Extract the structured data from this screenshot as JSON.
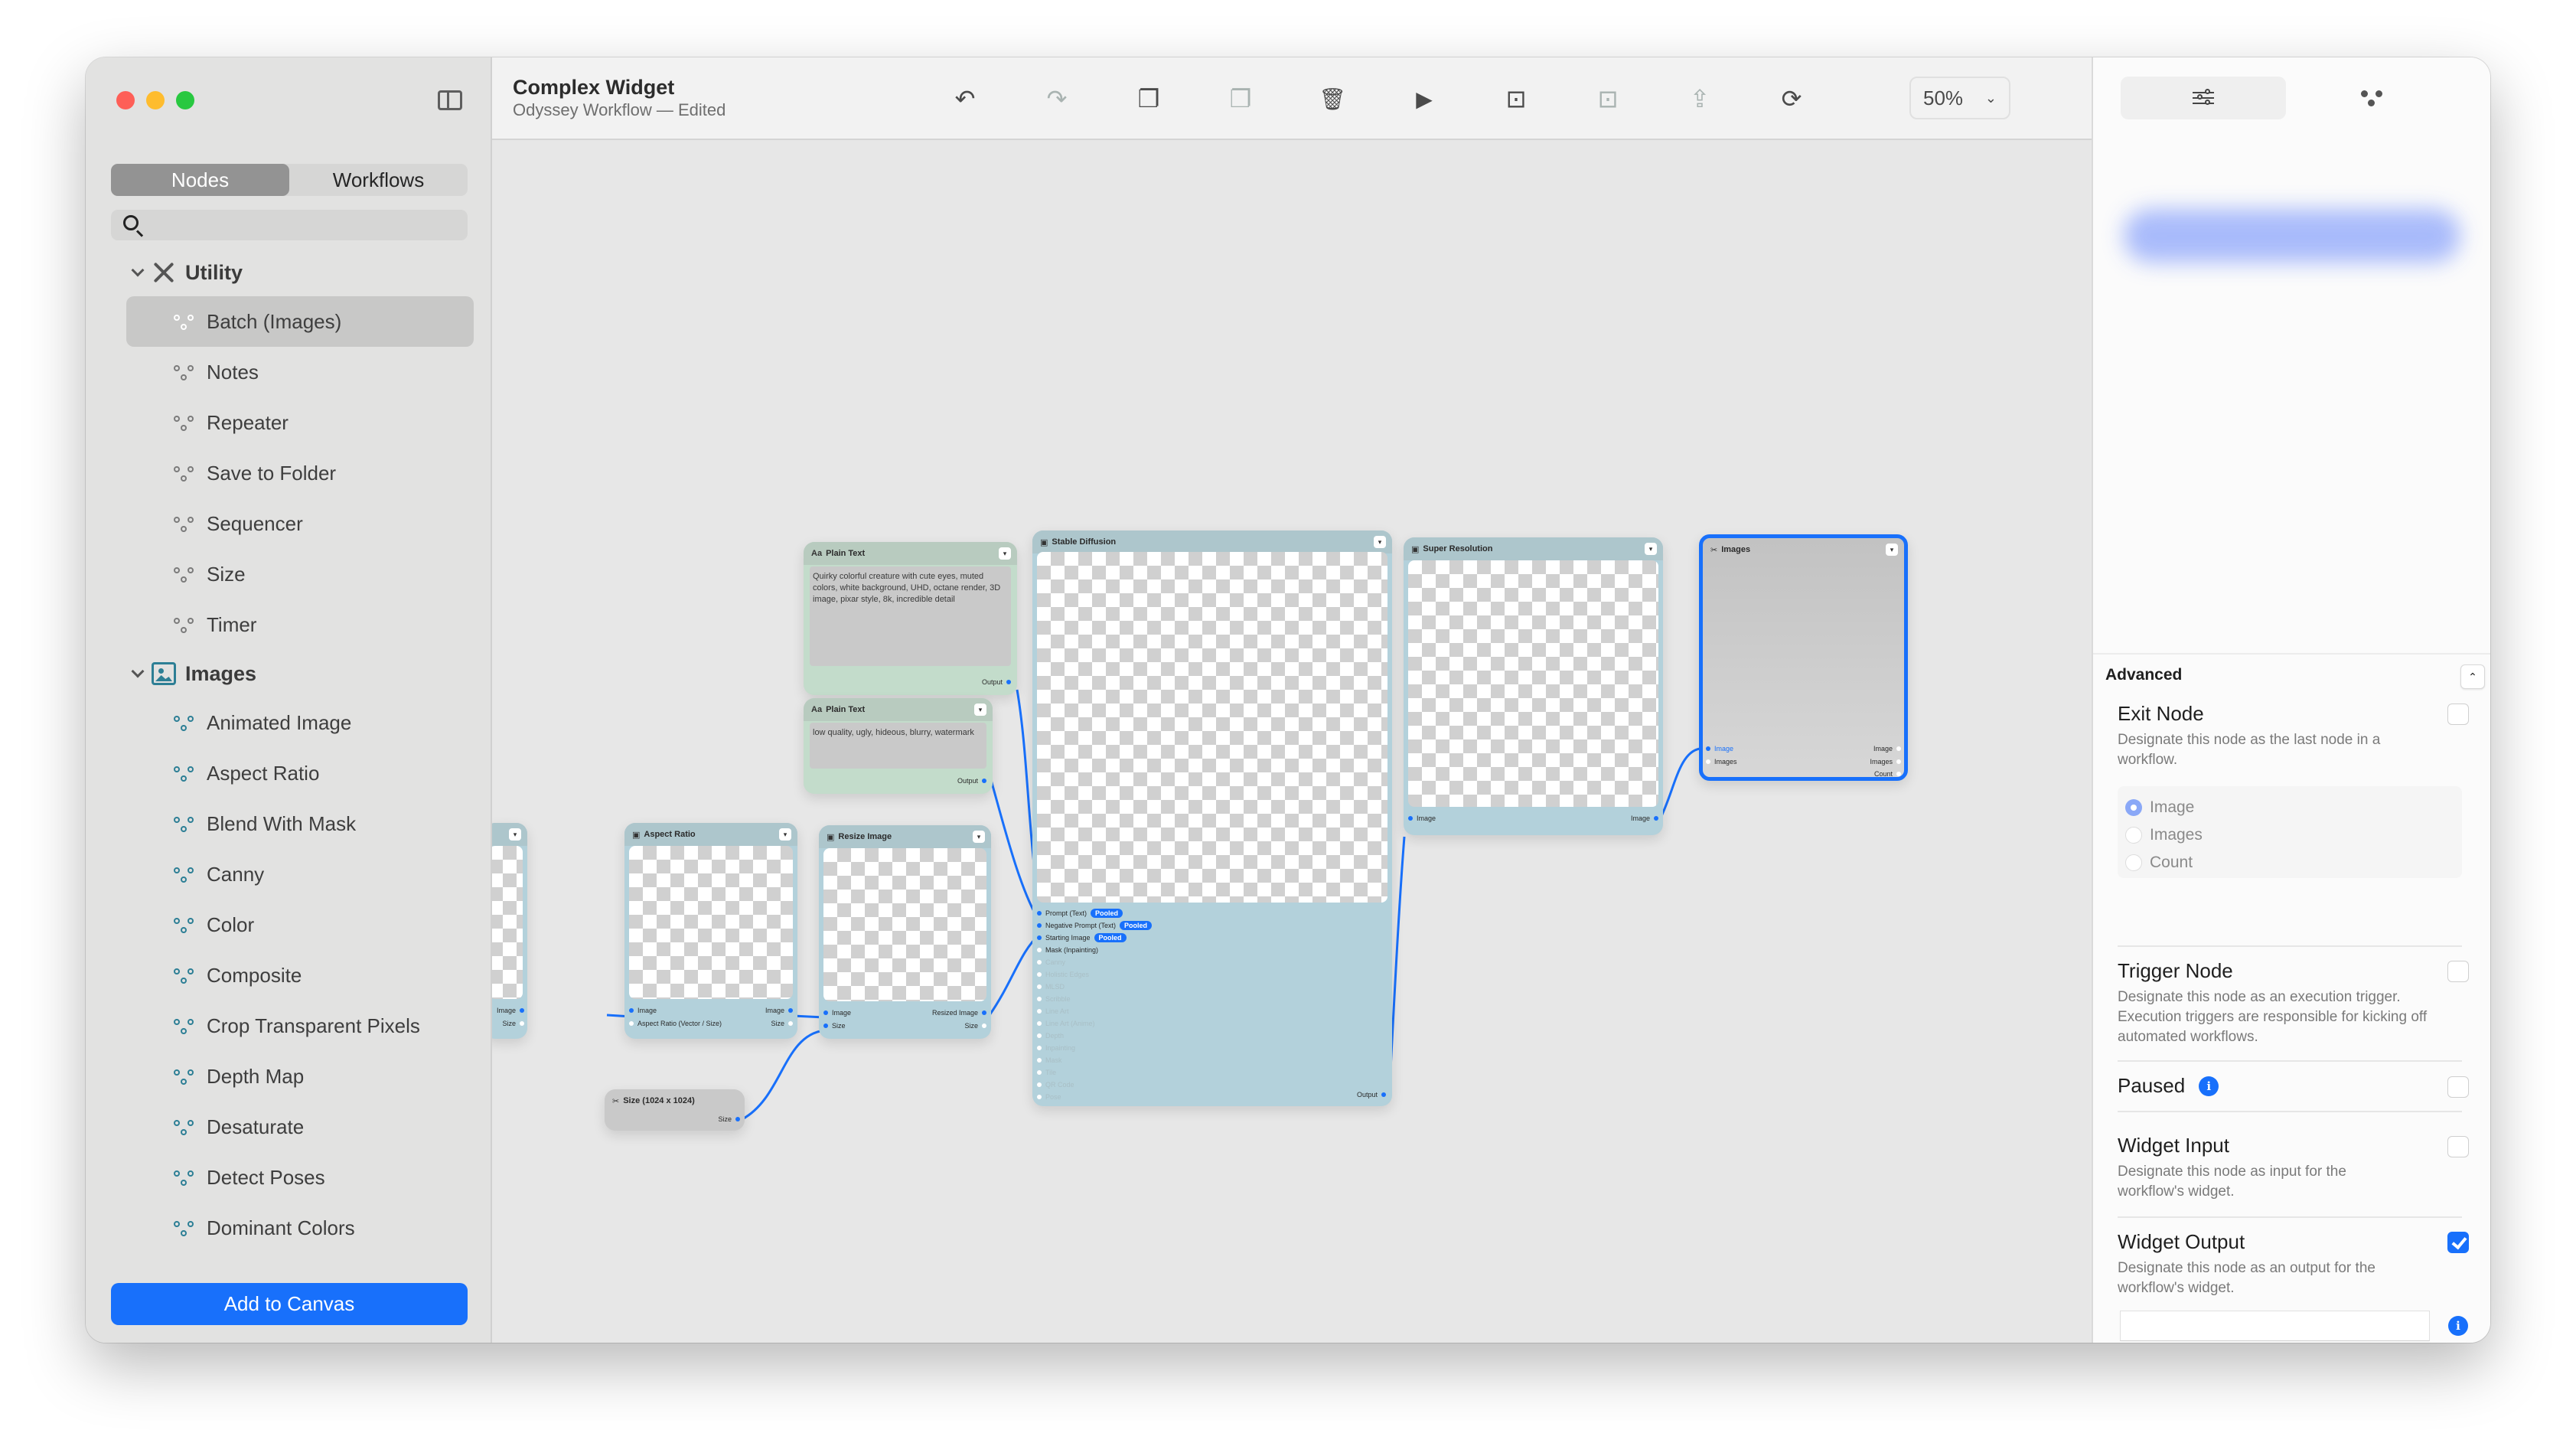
{
  "window": {
    "title": "Complex Widget",
    "subtitle": "Odyssey Workflow — Edited"
  },
  "sidebar": {
    "tabs": [
      {
        "label": "Nodes",
        "active": true
      },
      {
        "label": "Workflows",
        "active": false
      }
    ],
    "search": {
      "value": "",
      "placeholder": ""
    },
    "groups": [
      {
        "label": "Utility",
        "icon": "tools-icon",
        "expanded": true,
        "items": [
          {
            "label": "Batch (Images)",
            "selected": true
          },
          {
            "label": "Notes"
          },
          {
            "label": "Repeater"
          },
          {
            "label": "Save to Folder"
          },
          {
            "label": "Sequencer"
          },
          {
            "label": "Size"
          },
          {
            "label": "Timer"
          }
        ]
      },
      {
        "label": "Images",
        "icon": "photo-icon",
        "expanded": true,
        "items": [
          {
            "label": "Animated Image"
          },
          {
            "label": "Aspect Ratio"
          },
          {
            "label": "Blend With Mask"
          },
          {
            "label": "Canny"
          },
          {
            "label": "Color"
          },
          {
            "label": "Composite"
          },
          {
            "label": "Crop Transparent Pixels"
          },
          {
            "label": "Depth Map"
          },
          {
            "label": "Desaturate"
          },
          {
            "label": "Detect Poses"
          },
          {
            "label": "Dominant Colors"
          }
        ]
      }
    ],
    "add_button": "Add to Canvas"
  },
  "toolbar": {
    "buttons": [
      {
        "name": "undo",
        "icon": "↶",
        "enabled": true
      },
      {
        "name": "redo",
        "icon": "↷",
        "enabled": false
      },
      {
        "name": "copy",
        "icon": "❐",
        "enabled": true
      },
      {
        "name": "paste",
        "icon": "❐",
        "enabled": false
      },
      {
        "name": "delete",
        "icon": "🗑",
        "enabled": true
      },
      {
        "name": "run",
        "icon": "▶",
        "enabled": true
      },
      {
        "name": "fit-height",
        "icon": "⊡",
        "enabled": true
      },
      {
        "name": "fit-height-alt",
        "icon": "⊡",
        "enabled": false
      },
      {
        "name": "share",
        "icon": "⇪",
        "enabled": false
      },
      {
        "name": "refresh",
        "icon": "⟳",
        "enabled": true
      }
    ],
    "zoom": "50%"
  },
  "canvas": {
    "nodes": {
      "plain_text_1": {
        "title": "Plain Text",
        "icon": "Aa",
        "text": "Quirky colorful creature with cute eyes, muted colors, white background, UHD, octane render, 3D image, pixar style, 8k, incredible detail",
        "output": "Output"
      },
      "plain_text_2": {
        "title": "Plain Text",
        "icon": "Aa",
        "text": "low quality, ugly, hideous, blurry, watermark",
        "output": "Output"
      },
      "stable_diffusion": {
        "title": "Stable Diffusion",
        "inputs": [
          {
            "label": "Prompt (Text)",
            "badge": "Pooled",
            "connected": true
          },
          {
            "label": "Negative Prompt (Text)",
            "badge": "Pooled",
            "connected": true
          },
          {
            "label": "Starting Image",
            "badge": "Pooled",
            "connected": true
          },
          {
            "label": "Mask (Inpainting)",
            "connected": false
          },
          {
            "label": "Canny",
            "faded": true
          },
          {
            "label": "Holistic Edges",
            "faded": true
          },
          {
            "label": "MLSD",
            "faded": true
          },
          {
            "label": "Scribble",
            "faded": true
          },
          {
            "label": "Line Art",
            "faded": true
          },
          {
            "label": "Line Art (Anime)",
            "faded": true
          },
          {
            "label": "Depth",
            "faded": true
          },
          {
            "label": "Inpainting",
            "faded": true
          },
          {
            "label": "Mask",
            "faded": true
          },
          {
            "label": "Tile",
            "faded": true
          },
          {
            "label": "QR Code",
            "faded": true
          },
          {
            "label": "Pose",
            "faded": true
          }
        ],
        "output": "Output"
      },
      "super_resolution": {
        "title": "Super Resolution",
        "input": "Image",
        "output": "Image"
      },
      "images": {
        "title": "Images",
        "inputs": [
          "Image",
          "Images"
        ],
        "outputs": [
          "Image",
          "Images",
          "Count"
        ]
      },
      "partial_left": {
        "outputs": [
          "Image",
          "Size"
        ]
      },
      "aspect_ratio": {
        "title": "Aspect Ratio",
        "inputs": [
          "Image",
          "Aspect Ratio (Vector / Size)"
        ],
        "outputs": [
          "Image",
          "Size"
        ]
      },
      "resize_image": {
        "title": "Resize Image",
        "inputs": [
          "Image",
          "Size"
        ],
        "outputs": [
          "Resized Image",
          "Size"
        ]
      },
      "size": {
        "title": "Size (1024 x 1024)",
        "output": "Size"
      }
    }
  },
  "inspector": {
    "tabs": [
      {
        "name": "settings",
        "active": true
      },
      {
        "name": "graph",
        "active": false
      }
    ],
    "advanced": {
      "title": "Advanced",
      "expanded": true,
      "exit_node": {
        "title": "Exit Node",
        "desc": "Designate this node as the last node in a workflow.",
        "checked": false,
        "options": [
          {
            "label": "Image",
            "selected": true
          },
          {
            "label": "Images",
            "selected": false
          },
          {
            "label": "Count",
            "selected": false
          }
        ]
      },
      "trigger_node": {
        "title": "Trigger Node",
        "desc": "Designate this node as an execution trigger. Execution triggers are responsible for kicking off automated workflows.",
        "checked": false
      },
      "paused": {
        "title": "Paused",
        "checked": false
      },
      "widget_input": {
        "title": "Widget Input",
        "desc": "Designate this node as input for the workflow's widget.",
        "checked": false
      },
      "widget_output": {
        "title": "Widget Output",
        "desc": "Designate this node as an output for the workflow's widget.",
        "checked": true,
        "field_value": ""
      }
    }
  },
  "colors": {
    "accent": "#1870fb",
    "image_node": "#b3d1db",
    "text_node": "#c3dccb",
    "utility_node": "#c9c9c9",
    "teal_icon": "#2d7f95"
  }
}
